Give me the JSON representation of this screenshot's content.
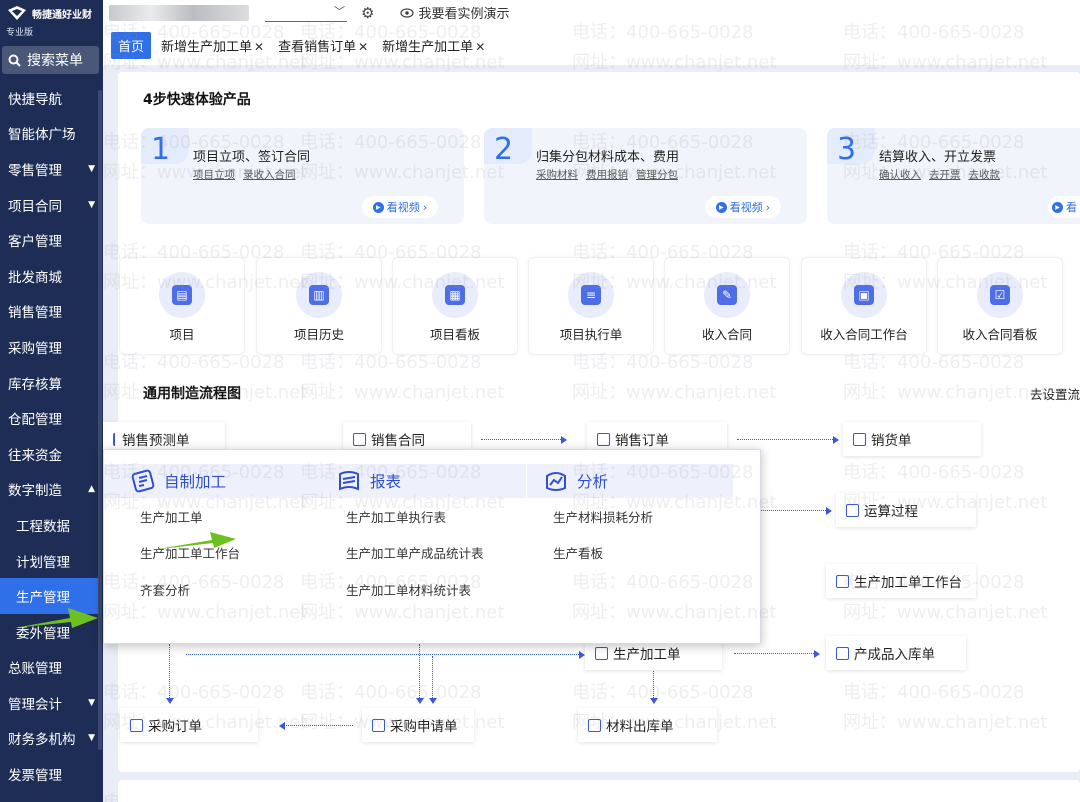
{
  "brand": {
    "name": "畅捷通好业财",
    "edition": "专业版"
  },
  "sidebar": {
    "search_label": "搜索菜单",
    "items": [
      {
        "label": "快捷导航",
        "caret": ""
      },
      {
        "label": "智能体广场",
        "caret": ""
      },
      {
        "label": "零售管理",
        "caret": "▼"
      },
      {
        "label": "项目合同",
        "caret": "▼"
      },
      {
        "label": "客户管理",
        "caret": ""
      },
      {
        "label": "批发商城",
        "caret": ""
      },
      {
        "label": "销售管理",
        "caret": ""
      },
      {
        "label": "采购管理",
        "caret": ""
      },
      {
        "label": "库存核算",
        "caret": ""
      },
      {
        "label": "仓配管理",
        "caret": ""
      },
      {
        "label": "往来资金",
        "caret": ""
      },
      {
        "label": "数字制造",
        "caret": "▲"
      },
      {
        "label": "工程数据",
        "caret": ""
      },
      {
        "label": "计划管理",
        "caret": ""
      },
      {
        "label": "生产管理",
        "caret": ""
      },
      {
        "label": "委外管理",
        "caret": ""
      },
      {
        "label": "总账管理",
        "caret": ""
      },
      {
        "label": "管理会计",
        "caret": "▼"
      },
      {
        "label": "财务多机构",
        "caret": "▼"
      },
      {
        "label": "发票管理",
        "caret": ""
      }
    ]
  },
  "topbar": {
    "demo_label": "我要看实例演示"
  },
  "tabs": [
    {
      "label": "首页",
      "closable": false
    },
    {
      "label": "新增生产加工单",
      "closable": true
    },
    {
      "label": "查看销售订单",
      "closable": true
    },
    {
      "label": "新增生产加工单",
      "closable": true
    }
  ],
  "quickstart": {
    "title": "4步快速体验产品",
    "steps": [
      {
        "num": "1",
        "title": "项目立项、签订合同",
        "links": [
          "项目立项",
          "录收入合同"
        ],
        "video": "看视频"
      },
      {
        "num": "2",
        "title": "归集分包材料成本、费用",
        "links": [
          "采购材料",
          "费用报销",
          "管理分包"
        ],
        "video": "看视频"
      },
      {
        "num": "3",
        "title": "结算收入、开立发票",
        "links": [
          "确认收入",
          "去开票",
          "去收款"
        ],
        "video": "看"
      }
    ]
  },
  "quick_entries": [
    {
      "label": "项目",
      "icon": "document-icon"
    },
    {
      "label": "项目历史",
      "icon": "chart-icon"
    },
    {
      "label": "项目看板",
      "icon": "board-icon"
    },
    {
      "label": "项目执行单",
      "icon": "list-icon"
    },
    {
      "label": "收入合同",
      "icon": "edit-icon"
    },
    {
      "label": "收入合同工作台",
      "icon": "workbench-icon"
    },
    {
      "label": "收入合同看板",
      "icon": "clipboard-icon"
    }
  ],
  "flow": {
    "title": "通用制造流程图",
    "settings_link": "去设置流",
    "nodes": {
      "sales_forecast": "销售预测单",
      "sales_contract": "销售合同",
      "sales_order": "销售订单",
      "sales_delivery": "销货单",
      "calc_process": "运算过程",
      "production_workbench": "生产加工单工作台",
      "production_order": "生产加工单",
      "finished_goods_in": "产成品入库单",
      "purchase_order": "采购订单",
      "purchase_request": "采购申请单",
      "material_out": "材料出库单"
    }
  },
  "popup": {
    "columns": [
      {
        "title": "自制加工",
        "icon": "manufacture-icon",
        "items": [
          "生产加工单",
          "生产加工单工作台",
          "齐套分析"
        ]
      },
      {
        "title": "报表",
        "icon": "report-icon",
        "items": [
          "生产加工单执行表",
          "生产加工单产成品统计表",
          "生产加工单材料统计表"
        ]
      },
      {
        "title": "分析",
        "icon": "analysis-icon",
        "items": [
          "生产材料损耗分析",
          "生产看板"
        ]
      }
    ]
  },
  "watermark": {
    "phone": "电话：400-665-0028",
    "site": "网址：www.chanjet.net"
  },
  "colors": {
    "sidebar_bg": "#1d2d55",
    "accent": "#2f6fe8",
    "flow_line": "#3a58d8",
    "annotation_arrow": "#6cc11f"
  }
}
